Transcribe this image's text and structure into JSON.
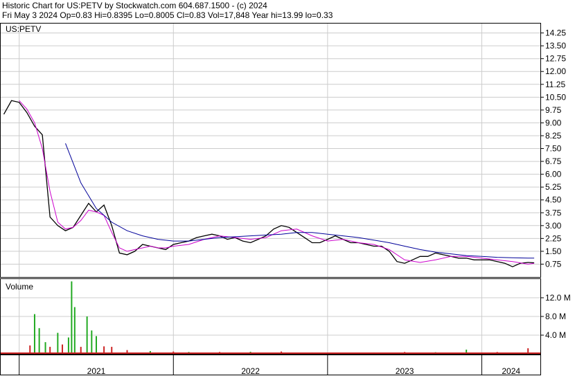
{
  "header": {
    "line1": "Historic Chart for US:PETV by Stockwatch.com 604.687.1500 - (c) 2024",
    "line2": "Fri May  3 2024  Op=0.83  Hi=0.8395  Lo=0.8005  Cl=0.83  Vol=17,848  Year hi=13.99  lo=0.33"
  },
  "colors": {
    "price": "#000000",
    "ma_short": "#cc00cc",
    "ma_long": "#000099",
    "vol_up": "#22aa22",
    "vol_down": "#cc2222",
    "grid": "#cccccc"
  },
  "chart_data": [
    {
      "type": "line",
      "title": "US:PETV",
      "ylabel": "",
      "xlabel": "",
      "ylim": [
        0,
        14.8
      ],
      "y_ticks": [
        "14.25",
        "13.50",
        "12.75",
        "12.00",
        "11.25",
        "10.50",
        "9.75",
        "9.00",
        "8.25",
        "7.50",
        "6.75",
        "6.00",
        "5.25",
        "4.50",
        "3.75",
        "3.00",
        "2.25",
        "1.50",
        "0.75"
      ],
      "x_ticks": [
        "2021",
        "2022",
        "2023",
        "2024"
      ],
      "grid": true,
      "series": [
        {
          "role": "price",
          "x": [
            2020.9,
            2020.95,
            2021.0,
            2021.05,
            2021.1,
            2021.15,
            2021.2,
            2021.25,
            2021.3,
            2021.35,
            2021.4,
            2021.45,
            2021.5,
            2021.55,
            2021.6,
            2021.65,
            2021.7,
            2021.75,
            2021.8,
            2021.85,
            2021.9,
            2021.95,
            2022.0,
            2022.05,
            2022.1,
            2022.15,
            2022.2,
            2022.25,
            2022.3,
            2022.35,
            2022.4,
            2022.45,
            2022.5,
            2022.55,
            2022.6,
            2022.65,
            2022.7,
            2022.75,
            2022.8,
            2022.85,
            2022.9,
            2022.95,
            2023.0,
            2023.05,
            2023.1,
            2023.15,
            2023.2,
            2023.25,
            2023.3,
            2023.35,
            2023.4,
            2023.45,
            2023.5,
            2023.55,
            2023.6,
            2023.65,
            2023.7,
            2023.75,
            2023.8,
            2023.85,
            2023.9,
            2023.95,
            2024.0,
            2024.05,
            2024.1,
            2024.15,
            2024.2,
            2024.25,
            2024.3,
            2024.34
          ],
          "y": [
            9.5,
            10.3,
            10.2,
            9.6,
            8.8,
            8.3,
            3.5,
            3.0,
            2.7,
            2.9,
            3.6,
            4.3,
            3.8,
            4.2,
            3.0,
            1.4,
            1.3,
            1.5,
            1.9,
            1.8,
            1.7,
            1.6,
            1.9,
            2.0,
            2.1,
            2.3,
            2.4,
            2.5,
            2.4,
            2.2,
            2.3,
            2.1,
            2.0,
            2.2,
            2.4,
            2.8,
            3.0,
            2.9,
            2.6,
            2.3,
            2.0,
            2.0,
            2.2,
            2.4,
            2.2,
            2.0,
            2.0,
            1.9,
            1.8,
            1.8,
            1.5,
            0.9,
            0.8,
            1.0,
            1.2,
            1.2,
            1.4,
            1.3,
            1.2,
            1.1,
            1.1,
            1.0,
            1.0,
            1.0,
            0.9,
            0.8,
            0.6,
            0.8,
            0.85,
            0.83
          ]
        },
        {
          "role": "ma_short",
          "x": [
            2021.0,
            2021.05,
            2021.1,
            2021.15,
            2021.2,
            2021.25,
            2021.3,
            2021.35,
            2021.4,
            2021.45,
            2021.5,
            2021.55,
            2021.6,
            2021.65,
            2021.7,
            2021.75,
            2021.8,
            2021.85,
            2021.9,
            2021.95,
            2022.0,
            2022.1,
            2022.2,
            2022.3,
            2022.4,
            2022.5,
            2022.6,
            2022.7,
            2022.8,
            2022.9,
            2023.0,
            2023.1,
            2023.2,
            2023.3,
            2023.4,
            2023.5,
            2023.6,
            2023.7,
            2023.8,
            2023.9,
            2024.0,
            2024.1,
            2024.2,
            2024.3,
            2024.34
          ],
          "y": [
            10.3,
            9.8,
            9.0,
            7.5,
            5.0,
            3.2,
            2.8,
            2.9,
            3.3,
            3.9,
            3.8,
            3.6,
            2.6,
            1.7,
            1.5,
            1.6,
            1.7,
            1.8,
            1.7,
            1.7,
            1.8,
            1.9,
            2.2,
            2.4,
            2.3,
            2.2,
            2.3,
            2.7,
            2.8,
            2.4,
            2.1,
            2.2,
            2.0,
            1.9,
            1.6,
            1.0,
            0.85,
            1.0,
            1.2,
            1.2,
            1.1,
            1.0,
            0.9,
            0.75,
            0.8
          ]
        },
        {
          "role": "ma_long",
          "x": [
            2021.3,
            2021.4,
            2021.5,
            2021.6,
            2021.7,
            2021.8,
            2021.9,
            2022.0,
            2022.1,
            2022.2,
            2022.3,
            2022.4,
            2022.5,
            2022.6,
            2022.7,
            2022.8,
            2022.9,
            2023.0,
            2023.1,
            2023.2,
            2023.3,
            2023.4,
            2023.5,
            2023.6,
            2023.7,
            2023.8,
            2023.9,
            2024.0,
            2024.1,
            2024.2,
            2024.3,
            2024.34
          ],
          "y": [
            7.8,
            5.5,
            4.0,
            3.2,
            2.7,
            2.4,
            2.2,
            2.1,
            2.1,
            2.2,
            2.3,
            2.35,
            2.4,
            2.45,
            2.5,
            2.6,
            2.6,
            2.5,
            2.4,
            2.3,
            2.15,
            2.0,
            1.8,
            1.6,
            1.45,
            1.35,
            1.25,
            1.2,
            1.15,
            1.12,
            1.1,
            1.1
          ]
        }
      ]
    },
    {
      "type": "bar",
      "title": "Volume",
      "ylim": [
        0,
        16000000
      ],
      "y_ticks": [
        "12.0 M",
        "8.0 M",
        "4.0 M"
      ],
      "x": [
        2021.0,
        2021.07,
        2021.1,
        2021.13,
        2021.17,
        2021.2,
        2021.25,
        2021.28,
        2021.32,
        2021.34,
        2021.36,
        2021.4,
        2021.44,
        2021.47,
        2021.5,
        2021.55,
        2021.6,
        2021.7,
        2021.85,
        2022.0,
        2022.1,
        2022.3,
        2022.5,
        2022.7,
        2022.9,
        2023.1,
        2023.3,
        2023.5,
        2023.7,
        2023.9,
        2024.1,
        2024.3
      ],
      "values": [
        300000,
        1800000,
        8500000,
        5500000,
        2500000,
        1500000,
        4500000,
        2000000,
        3500000,
        15500000,
        10000000,
        1500000,
        8000000,
        5000000,
        3800000,
        1600000,
        1500000,
        800000,
        600000,
        500000,
        400000,
        400000,
        450000,
        500000,
        300000,
        250000,
        300000,
        400000,
        350000,
        900000,
        400000,
        1200000
      ],
      "colors": [
        "down",
        "down",
        "up",
        "up",
        "up",
        "down",
        "up",
        "down",
        "up",
        "up",
        "up",
        "down",
        "up",
        "up",
        "up",
        "down",
        "down",
        "down",
        "up",
        "down",
        "up",
        "down",
        "up",
        "down",
        "up",
        "down",
        "up",
        "down",
        "up",
        "up",
        "down",
        "down"
      ]
    }
  ]
}
